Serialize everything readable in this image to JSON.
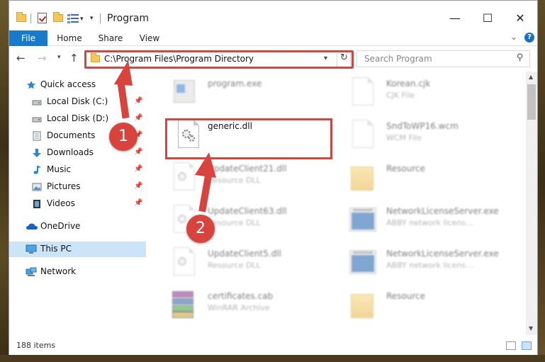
{
  "window": {
    "title": "Program",
    "controls": {
      "minimize": "—",
      "maximize": "☐",
      "close": "✕"
    }
  },
  "ribbon": {
    "tabs": [
      "File",
      "Home",
      "Share",
      "View"
    ],
    "help": "?"
  },
  "nav": {
    "address": "C:\\Program Files\\Program Directory",
    "search_placeholder": "Search Program"
  },
  "sidebar": {
    "items": [
      {
        "label": "Quick access",
        "icon": "star-icon"
      },
      {
        "label": "Local Disk (C:)",
        "icon": "drive-icon",
        "pinned": true
      },
      {
        "label": "Local Disk (D:)",
        "icon": "drive-icon",
        "pinned": true
      },
      {
        "label": "Documents",
        "icon": "documents-icon",
        "pinned": true
      },
      {
        "label": "Downloads",
        "icon": "download-icon",
        "pinned": true
      },
      {
        "label": "Music",
        "icon": "music-icon",
        "pinned": true
      },
      {
        "label": "Pictures",
        "icon": "pictures-icon",
        "pinned": true
      },
      {
        "label": "Videos",
        "icon": "videos-icon",
        "pinned": true
      },
      {
        "label": "OneDrive",
        "icon": "cloud-icon"
      },
      {
        "label": "This PC",
        "icon": "computer-icon",
        "selected": true
      },
      {
        "label": "Network",
        "icon": "network-icon"
      }
    ]
  },
  "files": [
    {
      "name": "program.exe",
      "type": ""
    },
    {
      "name": "Korean.cjk",
      "type": "CJK File"
    },
    {
      "name": "generic.dll",
      "type": ""
    },
    {
      "name": "SndToWP16.wcm",
      "type": "WCM File"
    },
    {
      "name": "UpdateClient21.dll",
      "type": "Resource DLL"
    },
    {
      "name": "Resource",
      "type": ""
    },
    {
      "name": "UpdateClient63.dll",
      "type": "Resource DLL"
    },
    {
      "name": "NetworkLicenseServer.exe",
      "type": "ABBY network licens..."
    },
    {
      "name": "UpdateClient5.dll",
      "type": "Resource DLL"
    },
    {
      "name": "NetworkLicenseServer.exe",
      "type": "ABBY network licens..."
    },
    {
      "name": "certificates.cab",
      "type": "WinRAR Archive"
    },
    {
      "name": "Resource",
      "type": ""
    }
  ],
  "status": {
    "items": "188 items"
  },
  "annotations": {
    "step1": "1",
    "step2": "2"
  },
  "colors": {
    "highlight": "#d4453f",
    "accent": "#1979ca"
  }
}
